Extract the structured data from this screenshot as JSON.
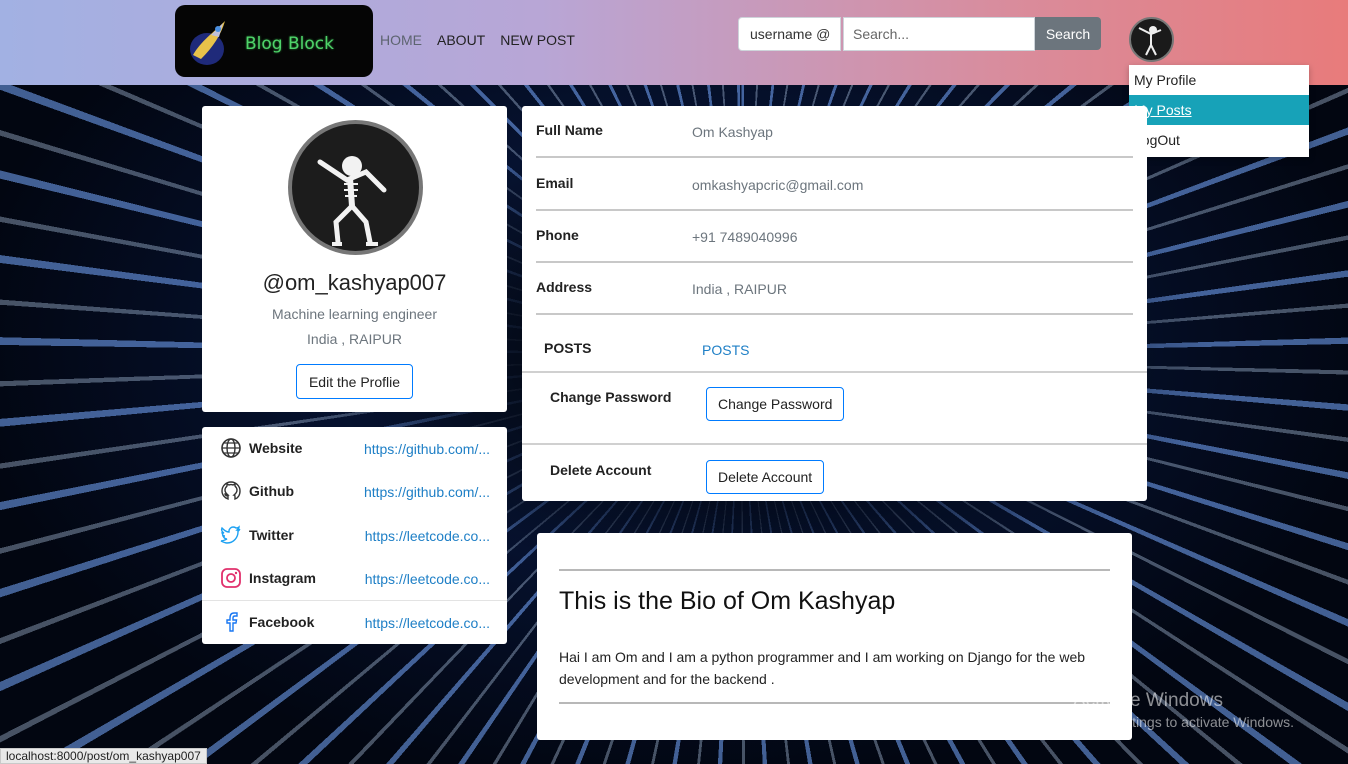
{
  "navbar": {
    "logo_text": "Blog Block",
    "links": [
      "HOME",
      "ABOUT",
      "NEW POST"
    ],
    "search_prefix": "username @",
    "search_placeholder": "Search...",
    "search_button": "Search"
  },
  "dropdown": {
    "items": [
      "My Profile",
      "My Posts",
      "LogOut"
    ],
    "active_index": 1
  },
  "profile": {
    "username": "@om_kashyap007",
    "job": "Machine learning engineer",
    "location": "India , RAIPUR",
    "edit_button": "Edit the Proflie"
  },
  "links": [
    {
      "label": "Website",
      "value": "https://github.com/...",
      "icon": "globe-icon"
    },
    {
      "label": "Github",
      "value": "https://github.com/...",
      "icon": "github-icon"
    },
    {
      "label": "Twitter",
      "value": "https://leetcode.co...",
      "icon": "twitter-icon"
    },
    {
      "label": "Instagram",
      "value": "https://leetcode.co...",
      "icon": "instagram-icon"
    },
    {
      "label": "Facebook",
      "value": "https://leetcode.co...",
      "icon": "facebook-icon"
    }
  ],
  "details": {
    "full_name_label": "Full Name",
    "full_name": "Om Kashyap",
    "email_label": "Email",
    "email": "omkashyapcric@gmail.com",
    "phone_label": "Phone",
    "phone": "+91 7489040996",
    "address_label": "Address",
    "address": "India , RAIPUR",
    "posts_label": "POSTS",
    "posts_link": "POSTS",
    "change_password_label": "Change Password",
    "change_password_button": "Change Password",
    "delete_account_label": "Delete Account",
    "delete_account_button": "Delete Account"
  },
  "bio": {
    "title": "This is the Bio of Om Kashyap",
    "text": "Hai I am Om and I am a python programmer and I am working on Django for the web development and for the backend ."
  },
  "os": {
    "watermark_title": "Activate Windows",
    "watermark_sub": "Go to Settings to activate Windows.",
    "status_url": "localhost:8000/post/om_kashyap007"
  },
  "colors": {
    "accent_blue": "#007bff",
    "dropdown_active": "#17a2b8",
    "link": "#1e7fc6"
  }
}
